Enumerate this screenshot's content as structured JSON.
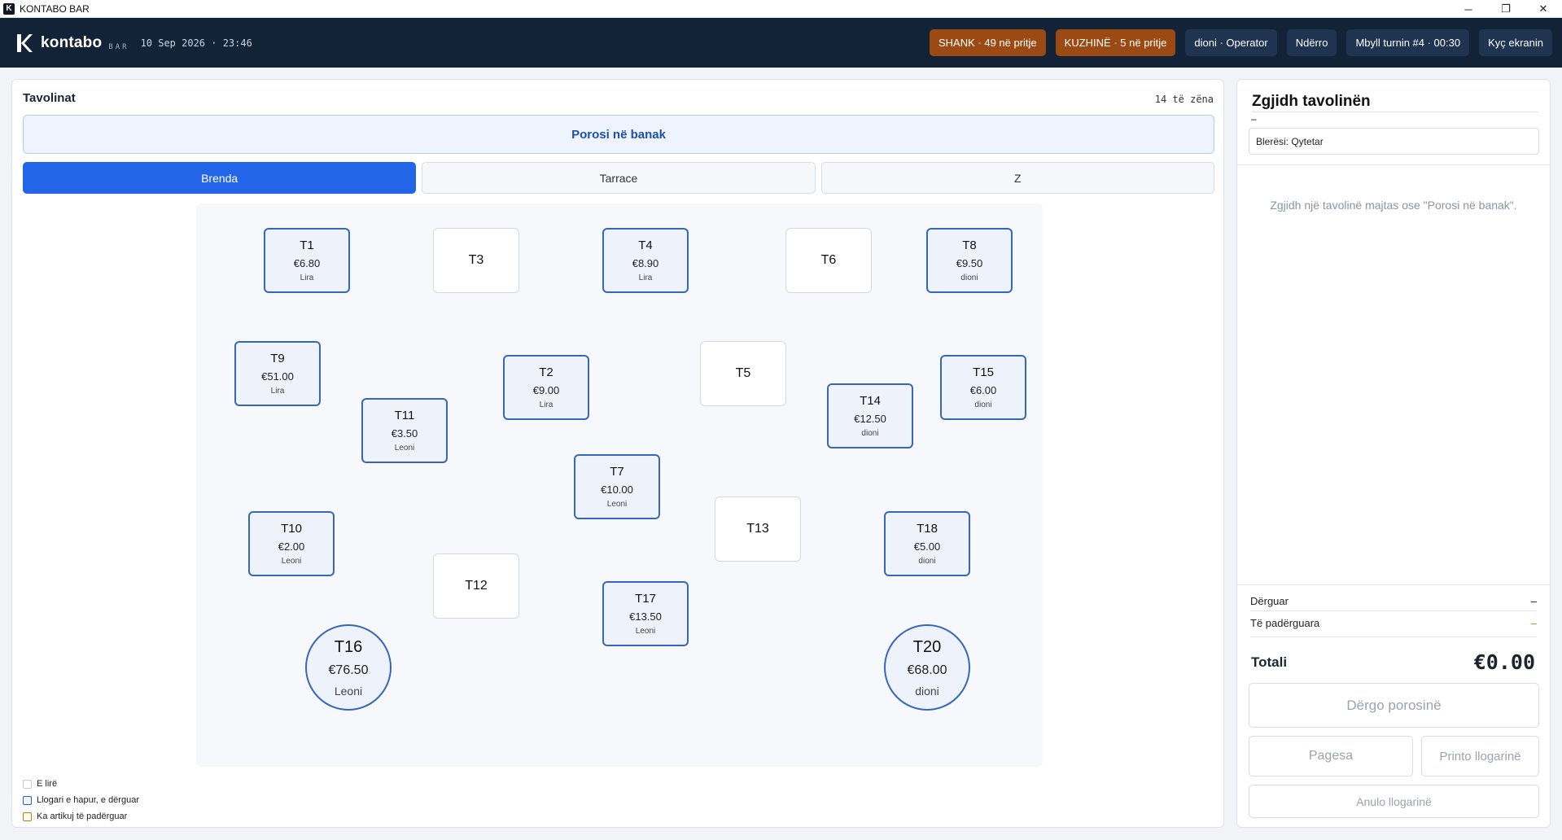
{
  "window": {
    "logo_letter": "K",
    "title": "KONTABO BAR",
    "minimize": "─",
    "restore": "❐",
    "close": "✕"
  },
  "header": {
    "brand_name": "kontabo",
    "brand_sub": "BAR",
    "datetime": "10 Sep 2026 · 23:46",
    "actions": {
      "bar_queue": "SHANK · 49 në pritje",
      "kitchen_queue": "KUZHINË · 5 në pritje",
      "user": "dioni · Operator",
      "change": "Ndërro",
      "close_shift": "Mbyll turnin #4 · 00:30",
      "lock": "Kyç ekranin"
    }
  },
  "tables_panel": {
    "title": "Tavolinat",
    "zone_count": "14 të zëna",
    "bar_order_button": "Porosi në banak",
    "zones": [
      "Brenda",
      "Tarrace",
      "Z"
    ],
    "active_zone": "Brenda",
    "tables": [
      {
        "name": "T1",
        "amount": "€6.80",
        "user": "Lira",
        "status": "open"
      },
      {
        "name": "T3",
        "amount": "",
        "user": "",
        "status": "free"
      },
      {
        "name": "T4",
        "amount": "€8.90",
        "user": "Lira",
        "status": "open"
      },
      {
        "name": "T6",
        "amount": "",
        "user": "",
        "status": "free"
      },
      {
        "name": "T8",
        "amount": "€9.50",
        "user": "dioni",
        "status": "open"
      },
      {
        "name": "T9",
        "amount": "€51.00",
        "user": "Lira",
        "status": "open"
      },
      {
        "name": "T2",
        "amount": "€9.00",
        "user": "Lira",
        "status": "open"
      },
      {
        "name": "T5",
        "amount": "",
        "user": "",
        "status": "free"
      },
      {
        "name": "T15",
        "amount": "€6.00",
        "user": "dioni",
        "status": "open"
      },
      {
        "name": "T11",
        "amount": "€3.50",
        "user": "Leoni",
        "status": "open"
      },
      {
        "name": "T14",
        "amount": "€12.50",
        "user": "dioni",
        "status": "open"
      },
      {
        "name": "T7",
        "amount": "€10.00",
        "user": "Leoni",
        "status": "open"
      },
      {
        "name": "T13",
        "amount": "",
        "user": "",
        "status": "free"
      },
      {
        "name": "T10",
        "amount": "€2.00",
        "user": "Leoni",
        "status": "open"
      },
      {
        "name": "T18",
        "amount": "€5.00",
        "user": "dioni",
        "status": "open"
      },
      {
        "name": "T12",
        "amount": "",
        "user": "",
        "status": "free"
      },
      {
        "name": "T17",
        "amount": "€13.50",
        "user": "Leoni",
        "status": "open"
      },
      {
        "name": "T16",
        "amount": "€76.50",
        "user": "Leoni",
        "status": "open",
        "shape": "round"
      },
      {
        "name": "T20",
        "amount": "€68.00",
        "user": "dioni",
        "status": "open",
        "shape": "round"
      }
    ],
    "legend": {
      "free": "E lirë",
      "open": "Llogari e hapur, e dërguar",
      "pending": "Ka artikuj të padërguar"
    }
  },
  "order_panel": {
    "title": "Zgjidh tavolinën",
    "subtitle": "–",
    "buyer": "Blerësi: Qytetar",
    "hint": "Zgjidh një tavolinë majtas ose \"Porosi në banak\".",
    "sent_label": "Dërguar",
    "sent_value": "–",
    "pending_label": "Të padërguara",
    "pending_value": "–",
    "total_label": "Totali",
    "total_value": "€0.00",
    "send_button": "Dërgo porosinë",
    "pay_button": "Pagesa",
    "print_button": "Printo llogarinë",
    "cancel_button": "Anulo llogarinë"
  },
  "colors": {
    "header_bg": "#132337",
    "accent": "#2265e8",
    "open_border": "#3667b8",
    "queue_badge": "#9a4a12",
    "pending": "#c47a14"
  }
}
